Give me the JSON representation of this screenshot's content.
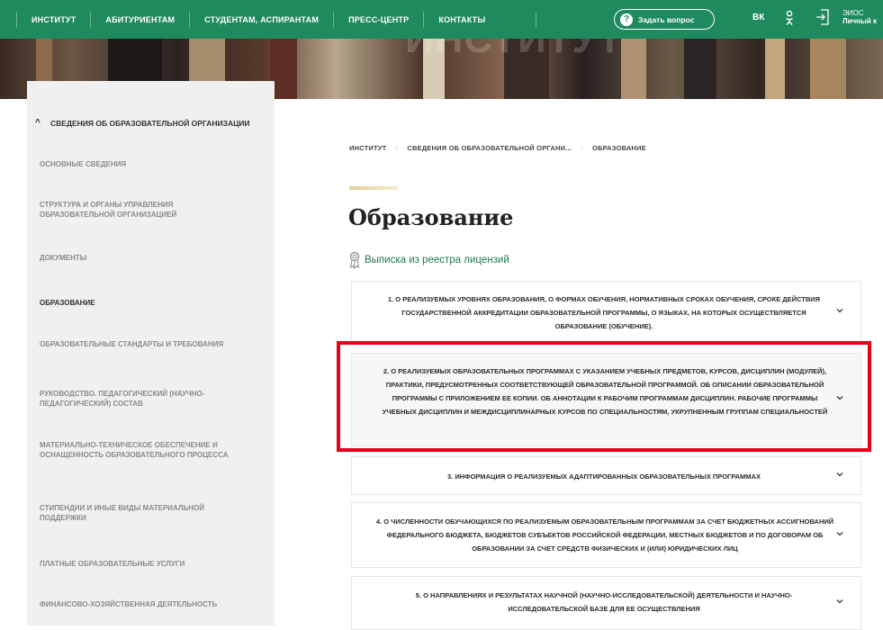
{
  "topnav": {
    "items": [
      "ИНСТИТУТ",
      "АБИТУРИЕНТАМ",
      "СТУДЕНТАМ, АСПИРАНТАМ",
      "ПРЕСС-ЦЕНТР",
      "КОНТАКТЫ"
    ],
    "ask_button": "Задать вопрос",
    "ask_icon_glyph": "?",
    "vk_label": "ВК",
    "eios_line1": "ЭИОС",
    "eios_line2": "Личный к"
  },
  "hero": {
    "watermark_title": "ИНСТИТУТ"
  },
  "sidebar": {
    "heading": "СВЕДЕНИЯ ОБ ОБРАЗОВАТЕЛЬНОЙ ОРГАНИЗАЦИИ",
    "collapse_glyph": "^",
    "items": [
      {
        "label": "ОСНОВНЫЕ СВЕДЕНИЯ",
        "active": false
      },
      {
        "label": "СТРУКТУРА И ОРГАНЫ УПРАВЛЕНИЯ ОБРАЗОВАТЕЛЬНОЙ ОРГАНИЗАЦИЕЙ",
        "active": false
      },
      {
        "label": "ДОКУМЕНТЫ",
        "active": false
      },
      {
        "label": "ОБРАЗОВАНИЕ",
        "active": true
      },
      {
        "label": "ОБРАЗОВАТЕЛЬНЫЕ СТАНДАРТЫ И ТРЕБОВАНИЯ",
        "active": false
      },
      {
        "label": "РУКОВОДСТВО. ПЕДАГОГИЧЕСКИЙ (НАУЧНО-ПЕДАГОГИЧЕСКИЙ) СОСТАВ",
        "active": false
      },
      {
        "label": "МАТЕРИАЛЬНО-ТЕХНИЧЕСКОЕ ОБЕСПЕЧЕНИЕ И ОСНАЩЕННОСТЬ ОБРАЗОВАТЕЛЬНОГО ПРОЦЕССА",
        "active": false
      },
      {
        "label": "СТИПЕНДИИ И ИНЫЕ ВИДЫ МАТЕРИАЛЬНОЙ ПОДДЕРЖКИ",
        "active": false
      },
      {
        "label": "ПЛАТНЫЕ ОБРАЗОВАТЕЛЬНЫЕ УСЛУГИ",
        "active": false
      },
      {
        "label": "ФИНАНСОВО-ХОЗЯЙСТВЕННАЯ ДЕЯТЕЛЬНОСТЬ",
        "active": false
      }
    ]
  },
  "breadcrumb": {
    "items": [
      "ИНСТИТУТ",
      "СВЕДЕНИЯ ОБ ОБРАЗОВАТЕЛЬНОЙ ОРГАНИ...",
      "ОБРАЗОВАНИЕ"
    ],
    "separator": "/"
  },
  "page": {
    "title": "Образование",
    "license_link": "Выписка из реестра лицензий"
  },
  "accordion": [
    {
      "text": "1. О РЕАЛИЗУЕМЫХ УРОВНЯХ ОБРАЗОВАНИЯ, О ФОРМАХ ОБУЧЕНИЯ, НОРМАТИВНЫХ СРОКАХ ОБУЧЕНИЯ, СРОКЕ ДЕЙСТВИЯ ГОСУДАРСТВЕННОЙ АККРЕДИТАЦИИ ОБРАЗОВАТЕЛЬНОЙ ПРОГРАММЫ, О ЯЗЫКАХ, НА КОТОРЫХ ОСУЩЕСТВЛЯЕТСЯ ОБРАЗОВАНИЕ (ОБУЧЕНИЕ)."
    },
    {
      "text": "2. О РЕАЛИЗУЕМЫХ ОБРАЗОВАТЕЛЬНЫХ ПРОГРАММАХ С УКАЗАНИЕМ УЧЕБНЫХ ПРЕДМЕТОВ, КУРСОВ, ДИСЦИПЛИН (МОДУЛЕЙ), ПРАКТИКИ, ПРЕДУСМОТРЕННЫХ СООТВЕТСТВУЮЩЕЙ ОБРАЗОВАТЕЛЬНОЙ ПРОГРАММОЙ. ОБ ОПИСАНИИ ОБРАЗОВАТЕЛЬНОЙ ПРОГРАММЫ С ПРИЛОЖЕНИЕМ ЕЕ КОПИИ. ОБ АННОТАЦИИ К РАБОЧИМ ПРОГРАММАМ ДИСЦИПЛИН. РАБОЧИЕ ПРОГРАММЫ УЧЕБНЫХ ДИСЦИПЛИН И МЕЖДИСЦИПЛИНАРНЫХ КУРСОВ ПО СПЕЦИАЛЬНОСТЯМ, УКРУПНЕННЫМ ГРУППАМ СПЕЦИАЛЬНОСТЕЙ"
    },
    {
      "text": "3. ИНФОРМАЦИЯ О РЕАЛИЗУЕМЫХ АДАПТИРОВАННЫХ ОБРАЗОВАТЕЛЬНЫХ ПРОГРАММАХ"
    },
    {
      "text": "4. О ЧИСЛЕННОСТИ ОБУЧАЮЩИХСЯ ПО РЕАЛИЗУЕМЫМ ОБРАЗОВАТЕЛЬНЫМ ПРОГРАММАМ ЗА СЧЕТ БЮДЖЕТНЫХ АССИГНОВАНИЙ ФЕДЕРАЛЬНОГО БЮДЖЕТА, БЮДЖЕТОВ СУБЪЕКТОВ РОССИЙСКОЙ ФЕДЕРАЦИИ, МЕСТНЫХ БЮДЖЕТОВ И ПО ДОГОВОРАМ ОБ ОБРАЗОВАНИИ ЗА СЧЕТ СРЕДСТВ ФИЗИЧЕСКИХ И (ИЛИ) ЮРИДИЧЕСКИХ ЛИЦ"
    },
    {
      "text": "5. О НАПРАВЛЕНИЯХ И РЕЗУЛЬТАТАХ НАУЧНОЙ (НАУЧНО-ИССЛЕДОВАТЕЛЬСКОЙ) ДЕЯТЕЛЬНОСТИ И НАУЧНО-ИССЛЕДОВАТЕЛЬСКОЙ БАЗЕ ДЛЯ ЕЕ ОСУЩЕСТВЛЕНИЯ"
    }
  ],
  "colors": {
    "brand_green": "#1f8a5e",
    "link_green": "#1f7a4d",
    "highlight_red": "#e6001a",
    "sidebar_bg": "#f0f0f0"
  }
}
